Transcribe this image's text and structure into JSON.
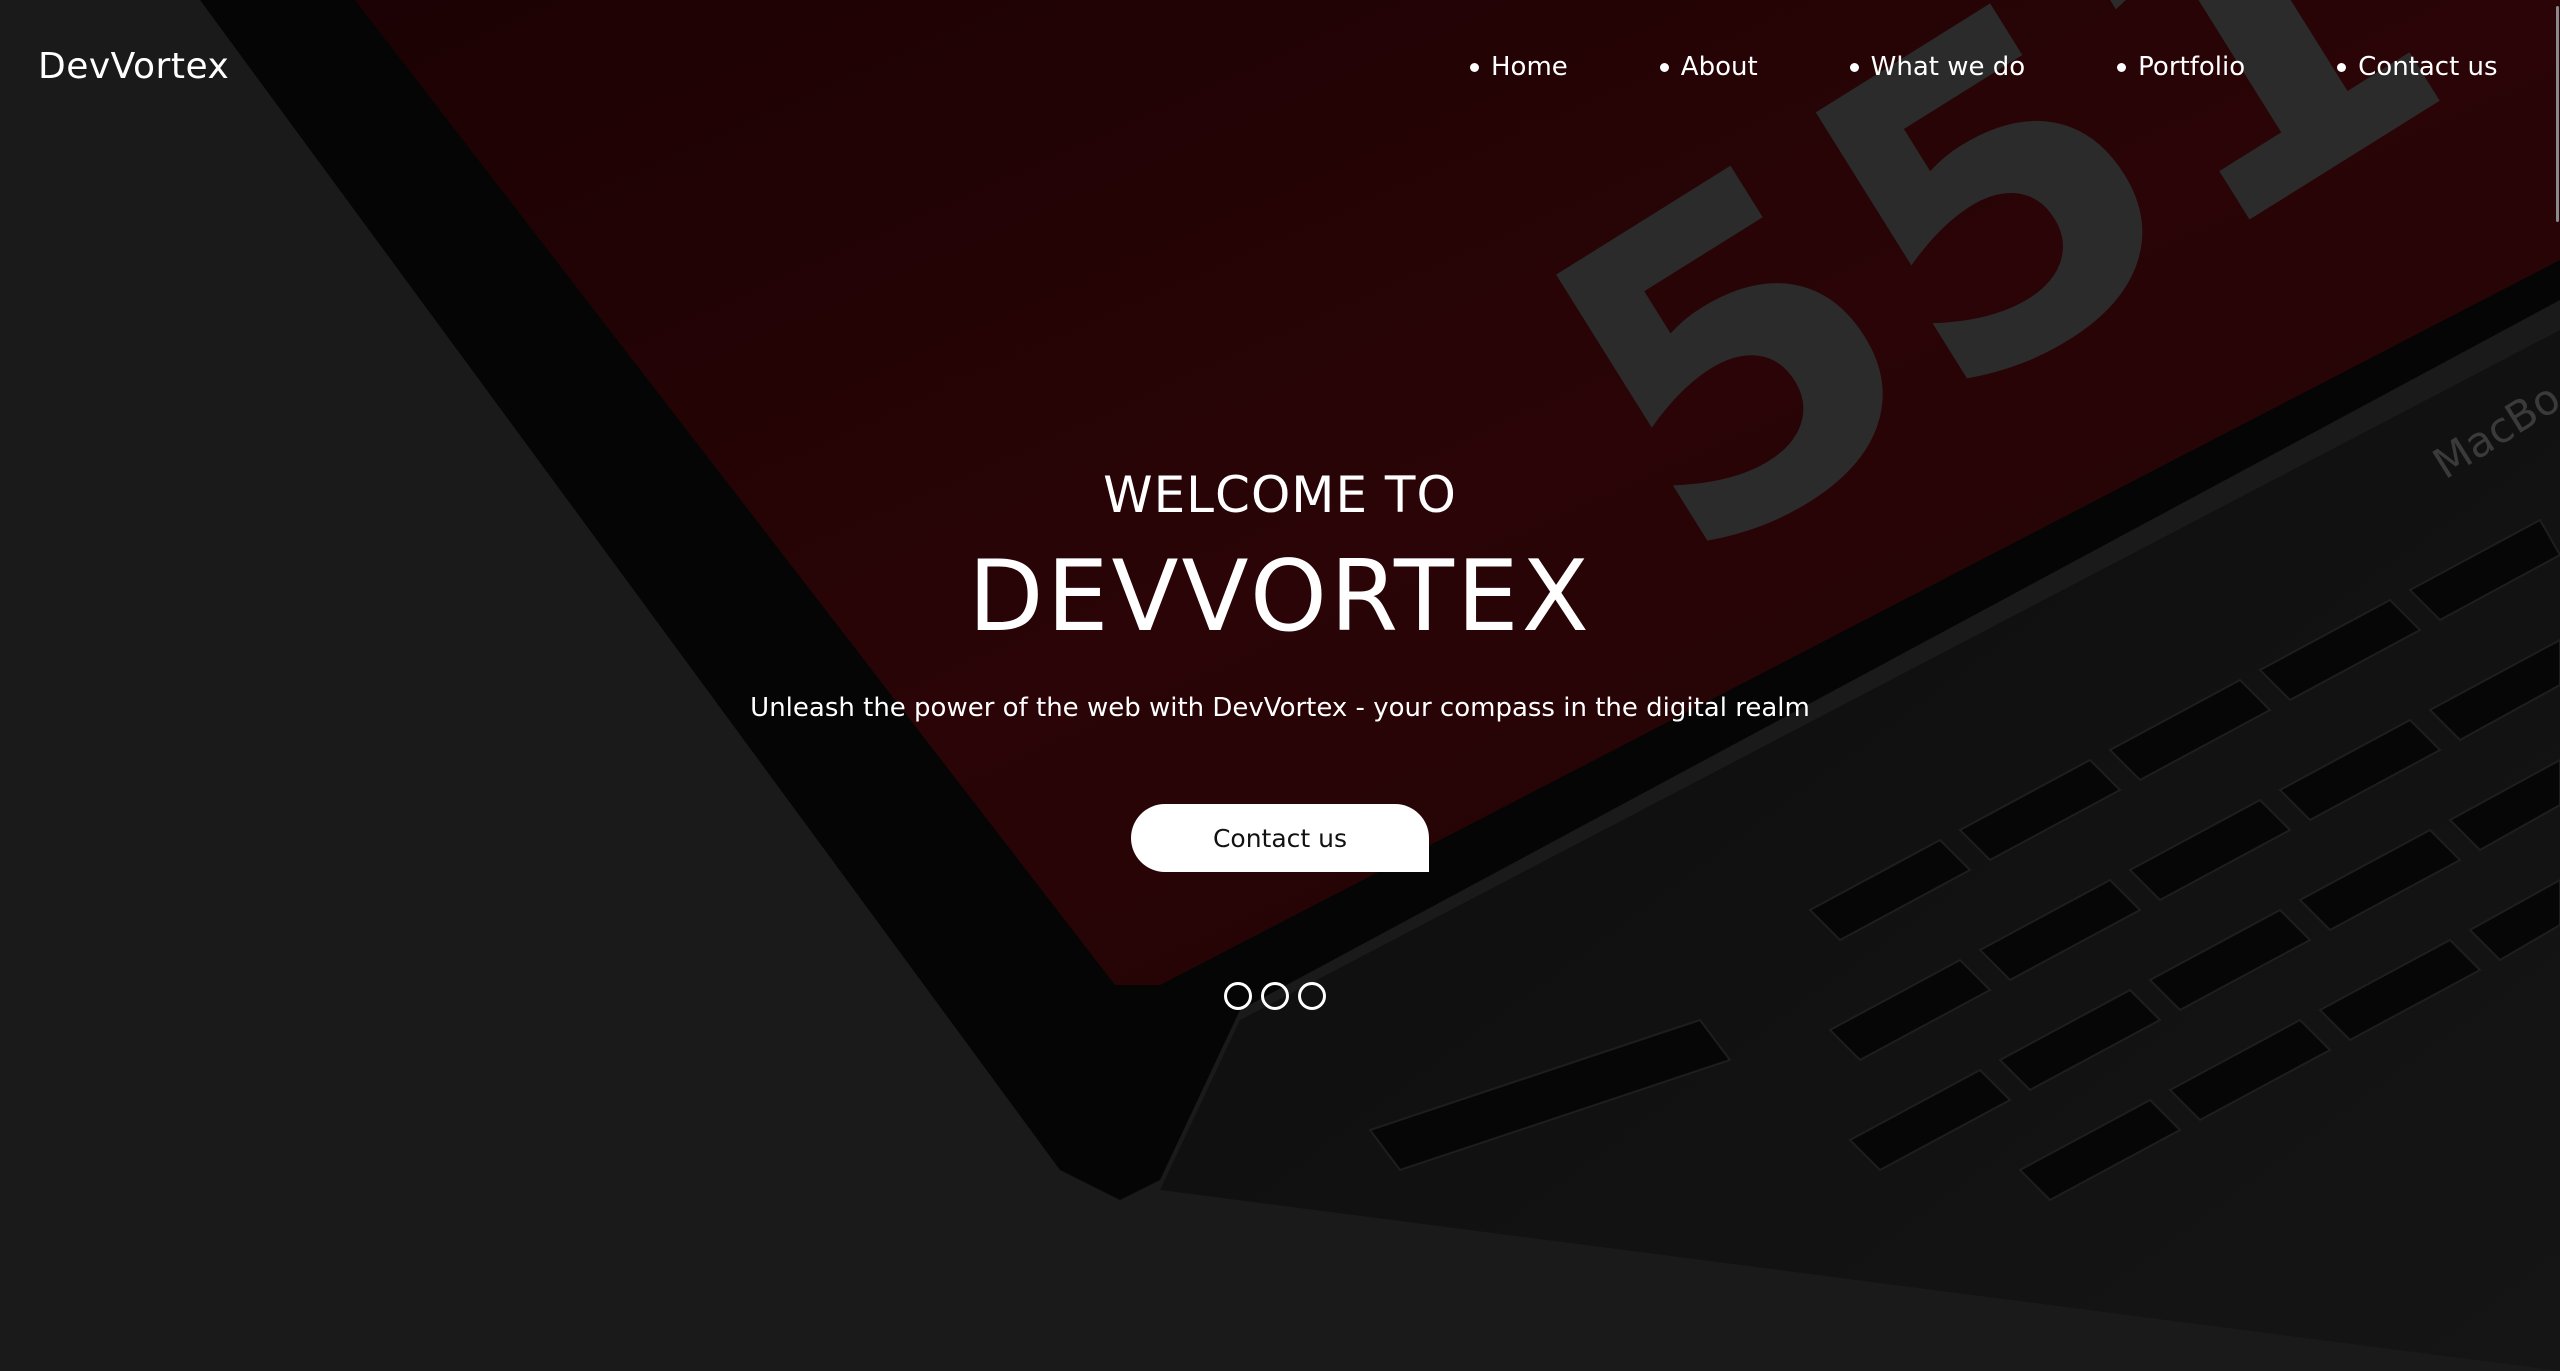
{
  "brand": {
    "name": "DevVortex"
  },
  "nav": {
    "items": [
      {
        "label": "Home"
      },
      {
        "label": "About"
      },
      {
        "label": "What we do"
      },
      {
        "label": "Portfolio"
      },
      {
        "label": "Contact us"
      }
    ]
  },
  "hero": {
    "welcome": "WELCOME TO",
    "title": "DEVVORTEX",
    "tagline": "Unleash the power of the web with DevVortex - your compass in the digital realm",
    "cta_label": "Contact us",
    "slide_count": 3,
    "bg_screen_text": "551",
    "bg_brand_text": "MacBo"
  },
  "colors": {
    "background": "#1a1a1a",
    "screen_red": "#2a0406",
    "text": "#ffffff",
    "button_bg": "#ffffff",
    "button_text": "#111111"
  }
}
